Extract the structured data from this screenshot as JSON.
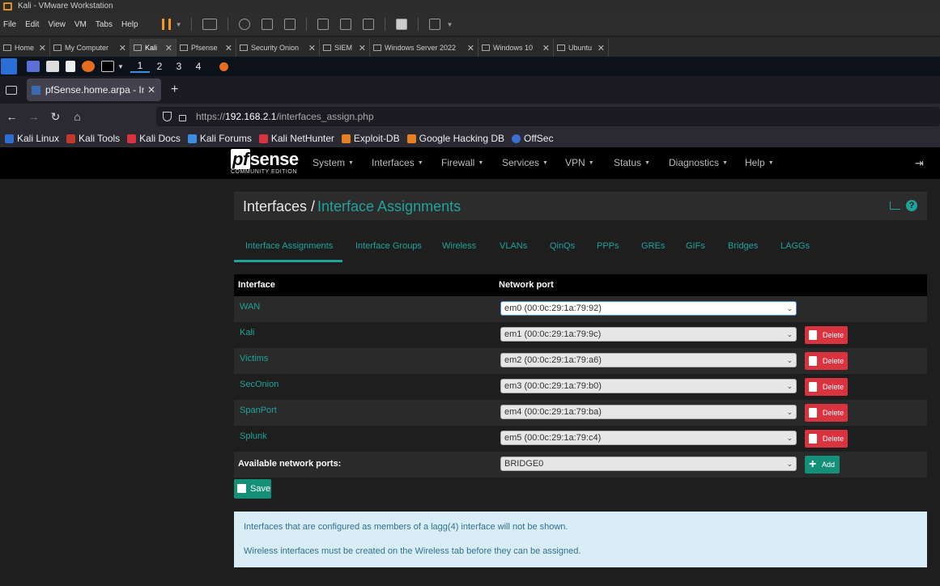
{
  "vmware": {
    "title": "Kali - VMware Workstation",
    "menu": [
      "File",
      "Edit",
      "View",
      "VM",
      "Tabs",
      "Help"
    ],
    "tabs": [
      {
        "label": "Home"
      },
      {
        "label": "My Computer"
      },
      {
        "label": "Kali",
        "active": true
      },
      {
        "label": "Pfsense"
      },
      {
        "label": "Security Onion"
      },
      {
        "label": "SIEM"
      },
      {
        "label": "Windows Server 2022"
      },
      {
        "label": "Windows 10"
      },
      {
        "label": "Ubuntu"
      }
    ]
  },
  "kali_panel": {
    "workspaces": [
      "1",
      "2",
      "3",
      "4"
    ],
    "active_workspace": "1"
  },
  "firefox": {
    "tab_title": "pfSense.home.arpa - Inte",
    "url_prefix": "https://",
    "url_host": "192.168.2.1",
    "url_path": "/interfaces_assign.php",
    "bookmarks": [
      "Kali Linux",
      "Kali Tools",
      "Kali Docs",
      "Kali Forums",
      "Kali NetHunter",
      "Exploit-DB",
      "Google Hacking DB",
      "OffSec"
    ]
  },
  "pfsense": {
    "logo": "pfsense",
    "edition": "COMMUNITY EDITION",
    "nav": [
      "System",
      "Interfaces",
      "Firewall",
      "Services",
      "VPN",
      "Status",
      "Diagnostics",
      "Help"
    ],
    "breadcrumb_root": "Interfaces /",
    "breadcrumb_current": "Interface Assignments",
    "tabs": [
      "Interface Assignments",
      "Interface Groups",
      "Wireless",
      "VLANs",
      "QinQs",
      "PPPs",
      "GREs",
      "GIFs",
      "Bridges",
      "LAGGs"
    ],
    "active_tab": "Interface Assignments",
    "table_headers": {
      "interface": "Interface",
      "port": "Network port"
    },
    "rows": [
      {
        "name": "WAN",
        "port": "em0 (00:0c:29:1a:79:92)"
      },
      {
        "name": "Kali",
        "port": "em1 (00:0c:29:1a:79:9c)"
      },
      {
        "name": "Victims",
        "port": "em2 (00:0c:29:1a:79:a6)"
      },
      {
        "name": "SecOnion",
        "port": "em3 (00:0c:29:1a:79:b0)"
      },
      {
        "name": "SpanPort",
        "port": "em4 (00:0c:29:1a:79:ba)"
      },
      {
        "name": "Splunk",
        "port": "em5 (00:0c:29:1a:79:c4)"
      }
    ],
    "delete_label": "Delete",
    "available_label": "Available network ports:",
    "available_port": "BRIDGE0",
    "add_label": "Add",
    "save_label": "Save",
    "info": [
      "Interfaces that are configured as members of a lagg(4) interface will not be shown.",
      "Wireless interfaces must be created on the Wireless tab before they can be assigned."
    ],
    "accent_color": "#1fa39a",
    "delete_color": "#d9333f",
    "action_color": "#149079"
  }
}
